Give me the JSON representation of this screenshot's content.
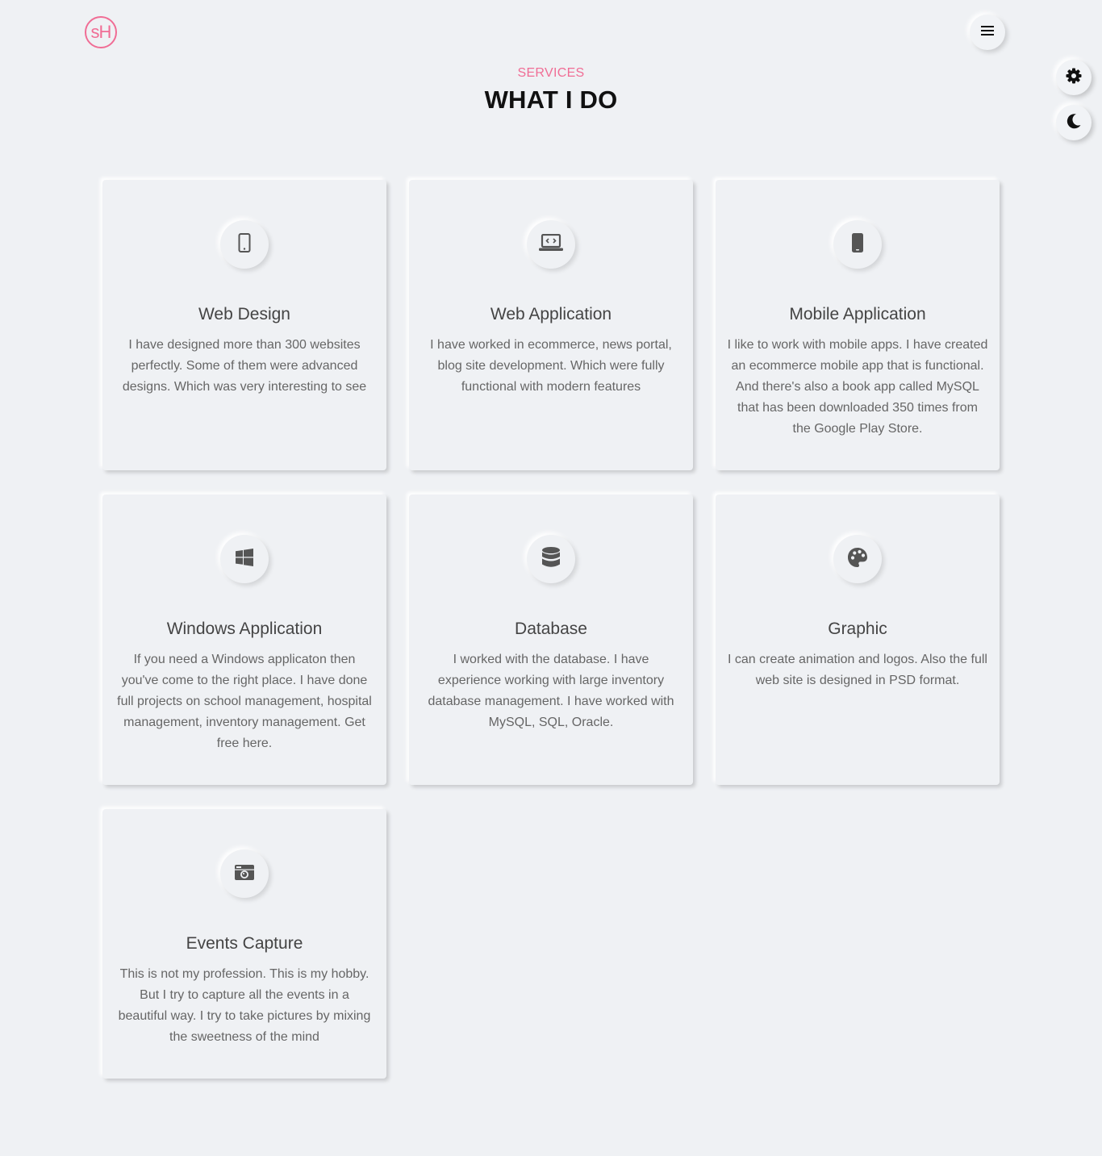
{
  "header": {
    "logo_text": "sH",
    "menu_icon": "hamburger-icon"
  },
  "side_controls": {
    "settings_icon": "gear-icon",
    "theme_icon": "moon-icon"
  },
  "section": {
    "subtitle": "SERVICES",
    "title": "WHAT I DO"
  },
  "services": [
    {
      "icon": "mobile-icon",
      "title": "Web Design",
      "description": "I have designed more than 300 websites perfectly. Some of them were advanced designs. Which was very interesting to see"
    },
    {
      "icon": "laptop-code-icon",
      "title": "Web Application",
      "description": "I have worked in ecommerce, news portal, blog site development. Which were fully functional with modern features"
    },
    {
      "icon": "mobile-solid-icon",
      "title": "Mobile Application",
      "description": "I like to work with mobile apps. I have created an ecommerce mobile app that is functional. And there's also a book app called MySQL that has been downloaded 350 times from the Google Play Store."
    },
    {
      "icon": "windows-icon",
      "title": "Windows Application",
      "description": "If you need a Windows applicaton then you've come to the right place. I have done full projects on school management, hospital management, inventory management. Get free here."
    },
    {
      "icon": "database-icon",
      "title": "Database",
      "description": "I worked with the database. I have experience working with large inventory database management. I have worked with MySQL, SQL, Oracle."
    },
    {
      "icon": "palette-icon",
      "title": "Graphic",
      "description": "I can create animation and logos. Also the full web site is designed in PSD format."
    },
    {
      "icon": "camera-retro-icon",
      "title": "Events Capture",
      "description": "This is not my profession. This is my hobby. But I try to capture all the events in a beautiful way. I try to take pictures by mixing the sweetness of the mind"
    }
  ],
  "colors": {
    "accent": "#f06d95",
    "background": "#eff1f4",
    "heading": "#111111",
    "icon": "#555555"
  }
}
